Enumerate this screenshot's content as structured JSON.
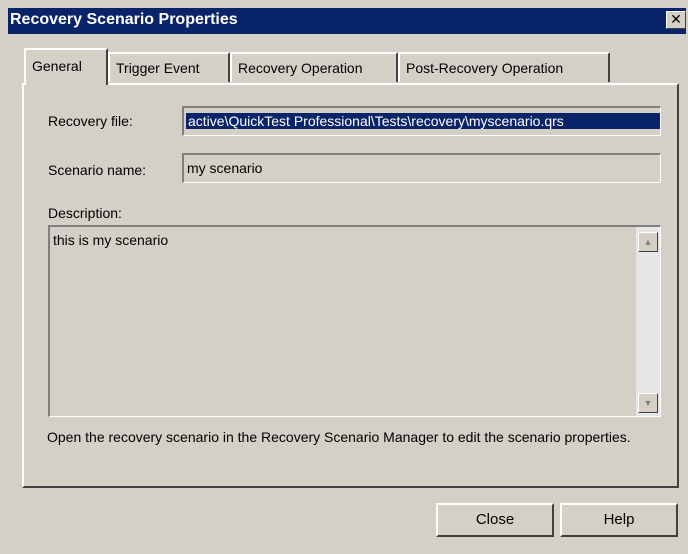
{
  "window": {
    "title": "Recovery Scenario Properties",
    "close_glyph": "✕"
  },
  "tabs": [
    {
      "label": "General",
      "active": true
    },
    {
      "label": "Trigger Event",
      "active": false
    },
    {
      "label": "Recovery Operation",
      "active": false
    },
    {
      "label": "Post-Recovery Operation",
      "active": false
    }
  ],
  "general": {
    "recovery_file_label": "Recovery file:",
    "recovery_file_value": "active\\QuickTest Professional\\Tests\\recovery\\myscenario.qrs",
    "scenario_name_label": "Scenario name:",
    "scenario_name_value": "my scenario",
    "description_label": "Description:",
    "description_value": "this is my scenario",
    "note": "Open the recovery scenario in the Recovery Scenario Manager to edit the scenario properties."
  },
  "buttons": {
    "close_label": "Close",
    "help_label": "Help"
  },
  "colors": {
    "titlebar": "#0a246a",
    "dialog_face": "#d4d0c8",
    "selection": "#0a246a"
  }
}
